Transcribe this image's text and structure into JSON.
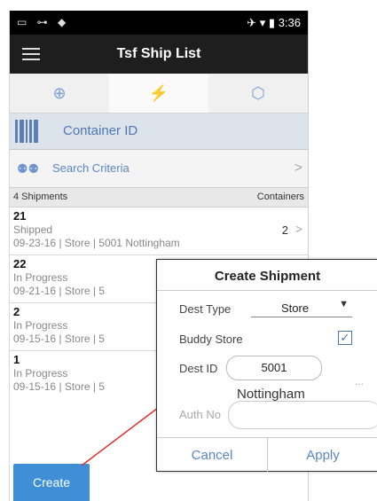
{
  "statusbar": {
    "left_icons": "▭ ⊶ ◆",
    "right_text": "✈ ▾ ▮ 3:36"
  },
  "header": {
    "title": "Tsf Ship List"
  },
  "tabs": [
    {
      "icon": "plus-circle-icon",
      "glyph": "⊕"
    },
    {
      "icon": "bolt-icon",
      "glyph": "⚡"
    },
    {
      "icon": "box-icon",
      "glyph": "⬡"
    }
  ],
  "container_row": {
    "label": "Container ID"
  },
  "search_row": {
    "label": "Search Criteria",
    "chevron": ">"
  },
  "summary": {
    "count_text": "4 Shipments",
    "right_header": "Containers"
  },
  "shipments": [
    {
      "number": "21",
      "status": "Shipped",
      "meta": "09-23-16  |  Store  |  5001 Nottingham",
      "containers": "2",
      "chevron": ">"
    },
    {
      "number": "22",
      "status": "In Progress",
      "meta": "09-21-16  |  Store  |  5",
      "containers": "",
      "chevron": ""
    },
    {
      "number": "2",
      "status": "In Progress",
      "meta": "09-15-16  |  Store  |  5",
      "containers": "",
      "chevron": ""
    },
    {
      "number": "1",
      "status": "In Progress",
      "meta": "09-15-16  |  Store  |  5",
      "containers": "",
      "chevron": ""
    }
  ],
  "create_button": {
    "label": "Create"
  },
  "dialog": {
    "title": "Create Shipment",
    "dest_type_label": "Dest Type",
    "dest_type_value": "Store",
    "buddy_store_label": "Buddy Store",
    "buddy_store_checked": true,
    "checkmark": "✓",
    "dest_id_label": "Dest ID",
    "dest_id_value": "5001",
    "lookup_dots": "...",
    "dest_name": "Nottingham",
    "auth_no_label": "Auth No",
    "auth_no_value": "",
    "cancel_label": "Cancel",
    "apply_label": "Apply"
  },
  "colors": {
    "accent": "#3f8fd6",
    "link": "#5b86c4",
    "titlebar": "#1e1e1e",
    "annotation_line": "#e03030"
  }
}
